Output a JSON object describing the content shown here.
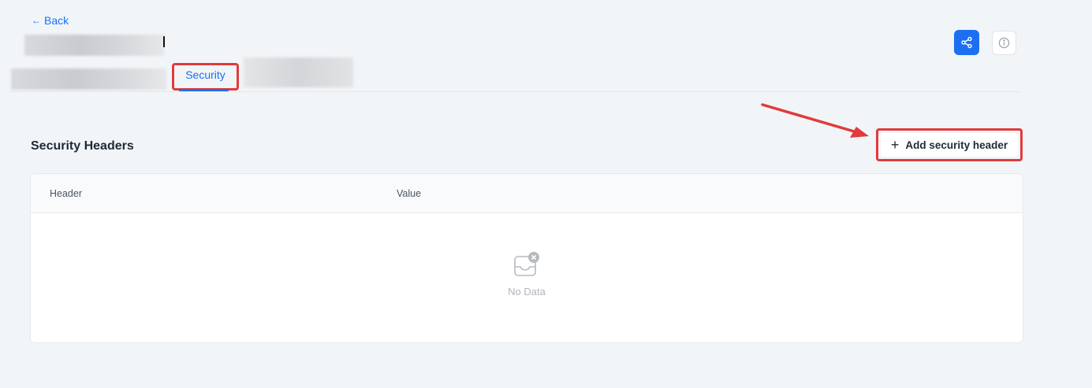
{
  "nav": {
    "back_label": "Back"
  },
  "tabs": [
    {
      "label": "Security",
      "active": true
    }
  ],
  "actions": {
    "share_icon": "share-icon",
    "info_icon": "info-icon"
  },
  "section": {
    "title": "Security Headers",
    "add_button_label": "Add security header"
  },
  "table": {
    "columns": [
      "Header",
      "Value"
    ],
    "rows": [],
    "empty_text": "No Data"
  },
  "colors": {
    "accent": "#1d6ff2",
    "highlight": "#e23a3a",
    "background": "#f1f5f8"
  }
}
